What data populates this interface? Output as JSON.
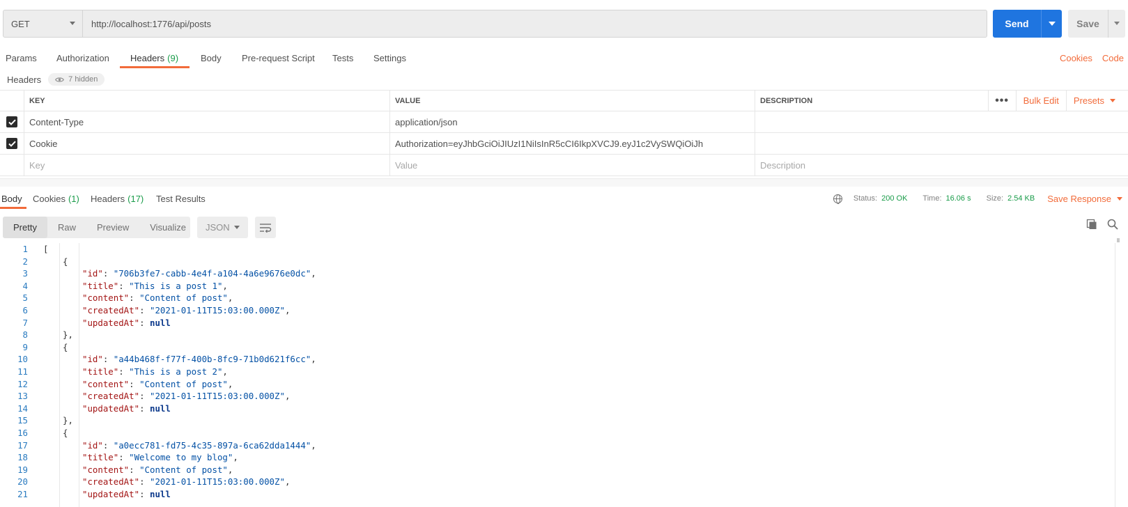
{
  "request": {
    "method": "GET",
    "url": "http://localhost:1776/api/posts",
    "send_label": "Send",
    "save_label": "Save"
  },
  "request_tabs": [
    {
      "label": "Params",
      "count": ""
    },
    {
      "label": "Authorization",
      "count": ""
    },
    {
      "label": "Headers",
      "count": "(9)"
    },
    {
      "label": "Body",
      "count": ""
    },
    {
      "label": "Pre-request Script",
      "count": ""
    },
    {
      "label": "Tests",
      "count": ""
    },
    {
      "label": "Settings",
      "count": ""
    }
  ],
  "active_request_tab": "Headers",
  "right_links": {
    "cookies": "Cookies",
    "code": "Code"
  },
  "headers_section": {
    "label": "Headers",
    "hidden_badge": "7 hidden"
  },
  "headers_table": {
    "columns": {
      "key": "KEY",
      "value": "VALUE",
      "description": "DESCRIPTION"
    },
    "actions": {
      "more": "•••",
      "bulk_edit": "Bulk Edit",
      "presets": "Presets"
    },
    "rows": [
      {
        "checked": true,
        "key": "Content-Type",
        "value": "application/json",
        "description": ""
      },
      {
        "checked": true,
        "key": "Cookie",
        "value": "Authorization=eyJhbGciOiJIUzI1NiIsInR5cCI6IkpXVCJ9.eyJ1c2VySWQiOiJh",
        "description": ""
      }
    ],
    "placeholders": {
      "key": "Key",
      "value": "Value",
      "description": "Description"
    }
  },
  "response_tabs": [
    {
      "label": "Body",
      "count": ""
    },
    {
      "label": "Cookies",
      "count": "(1)"
    },
    {
      "label": "Headers",
      "count": "(17)"
    },
    {
      "label": "Test Results",
      "count": ""
    }
  ],
  "active_response_tab": "Body",
  "response_status": {
    "status_label": "Status:",
    "status_value": "200 OK",
    "time_label": "Time:",
    "time_value": "16.06 s",
    "size_label": "Size:",
    "size_value": "2.54 KB",
    "save_response": "Save Response"
  },
  "view_modes": [
    "Pretty",
    "Raw",
    "Preview",
    "Visualize"
  ],
  "active_view_mode": "Pretty",
  "format": "JSON",
  "colors": {
    "accent": "#f26b3a",
    "send": "#1f75e0",
    "success": "#1a9c4a",
    "json_key": "#a31515",
    "json_string": "#0451a5",
    "json_null": "#0d3a8c",
    "line_number": "#2a7bc0"
  },
  "icons": {
    "eye": "eye-icon",
    "globe": "globe-icon",
    "wrap": "wrap-lines-icon",
    "copy": "copy-icon",
    "search": "search-icon"
  },
  "code_lines": [
    {
      "n": "1",
      "indent": 0,
      "parts": [
        {
          "t": "p",
          "v": "["
        }
      ]
    },
    {
      "n": "2",
      "indent": 1,
      "parts": [
        {
          "t": "p",
          "v": "{"
        }
      ]
    },
    {
      "n": "3",
      "indent": 2,
      "parts": [
        {
          "t": "k",
          "v": "\"id\""
        },
        {
          "t": "p",
          "v": ": "
        },
        {
          "t": "s",
          "v": "\"706b3fe7-cabb-4e4f-a104-4a6e9676e0dc\""
        },
        {
          "t": "p",
          "v": ","
        }
      ]
    },
    {
      "n": "4",
      "indent": 2,
      "parts": [
        {
          "t": "k",
          "v": "\"title\""
        },
        {
          "t": "p",
          "v": ": "
        },
        {
          "t": "s",
          "v": "\"This is a post 1\""
        },
        {
          "t": "p",
          "v": ","
        }
      ]
    },
    {
      "n": "5",
      "indent": 2,
      "parts": [
        {
          "t": "k",
          "v": "\"content\""
        },
        {
          "t": "p",
          "v": ": "
        },
        {
          "t": "s",
          "v": "\"Content of post\""
        },
        {
          "t": "p",
          "v": ","
        }
      ]
    },
    {
      "n": "6",
      "indent": 2,
      "parts": [
        {
          "t": "k",
          "v": "\"createdAt\""
        },
        {
          "t": "p",
          "v": ": "
        },
        {
          "t": "s",
          "v": "\"2021-01-11T15:03:00.000Z\""
        },
        {
          "t": "p",
          "v": ","
        }
      ]
    },
    {
      "n": "7",
      "indent": 2,
      "parts": [
        {
          "t": "k",
          "v": "\"updatedAt\""
        },
        {
          "t": "p",
          "v": ": "
        },
        {
          "t": "n",
          "v": "null"
        }
      ]
    },
    {
      "n": "8",
      "indent": 1,
      "parts": [
        {
          "t": "p",
          "v": "},"
        }
      ]
    },
    {
      "n": "9",
      "indent": 1,
      "parts": [
        {
          "t": "p",
          "v": "{"
        }
      ]
    },
    {
      "n": "10",
      "indent": 2,
      "parts": [
        {
          "t": "k",
          "v": "\"id\""
        },
        {
          "t": "p",
          "v": ": "
        },
        {
          "t": "s",
          "v": "\"a44b468f-f77f-400b-8fc9-71b0d621f6cc\""
        },
        {
          "t": "p",
          "v": ","
        }
      ]
    },
    {
      "n": "11",
      "indent": 2,
      "parts": [
        {
          "t": "k",
          "v": "\"title\""
        },
        {
          "t": "p",
          "v": ": "
        },
        {
          "t": "s",
          "v": "\"This is a post 2\""
        },
        {
          "t": "p",
          "v": ","
        }
      ]
    },
    {
      "n": "12",
      "indent": 2,
      "parts": [
        {
          "t": "k",
          "v": "\"content\""
        },
        {
          "t": "p",
          "v": ": "
        },
        {
          "t": "s",
          "v": "\"Content of post\""
        },
        {
          "t": "p",
          "v": ","
        }
      ]
    },
    {
      "n": "13",
      "indent": 2,
      "parts": [
        {
          "t": "k",
          "v": "\"createdAt\""
        },
        {
          "t": "p",
          "v": ": "
        },
        {
          "t": "s",
          "v": "\"2021-01-11T15:03:00.000Z\""
        },
        {
          "t": "p",
          "v": ","
        }
      ]
    },
    {
      "n": "14",
      "indent": 2,
      "parts": [
        {
          "t": "k",
          "v": "\"updatedAt\""
        },
        {
          "t": "p",
          "v": ": "
        },
        {
          "t": "n",
          "v": "null"
        }
      ]
    },
    {
      "n": "15",
      "indent": 1,
      "parts": [
        {
          "t": "p",
          "v": "},"
        }
      ]
    },
    {
      "n": "16",
      "indent": 1,
      "parts": [
        {
          "t": "p",
          "v": "{"
        }
      ]
    },
    {
      "n": "17",
      "indent": 2,
      "parts": [
        {
          "t": "k",
          "v": "\"id\""
        },
        {
          "t": "p",
          "v": ": "
        },
        {
          "t": "s",
          "v": "\"a0ecc781-fd75-4c35-897a-6ca62dda1444\""
        },
        {
          "t": "p",
          "v": ","
        }
      ]
    },
    {
      "n": "18",
      "indent": 2,
      "parts": [
        {
          "t": "k",
          "v": "\"title\""
        },
        {
          "t": "p",
          "v": ": "
        },
        {
          "t": "s",
          "v": "\"Welcome to my blog\""
        },
        {
          "t": "p",
          "v": ","
        }
      ]
    },
    {
      "n": "19",
      "indent": 2,
      "parts": [
        {
          "t": "k",
          "v": "\"content\""
        },
        {
          "t": "p",
          "v": ": "
        },
        {
          "t": "s",
          "v": "\"Content of post\""
        },
        {
          "t": "p",
          "v": ","
        }
      ]
    },
    {
      "n": "20",
      "indent": 2,
      "parts": [
        {
          "t": "k",
          "v": "\"createdAt\""
        },
        {
          "t": "p",
          "v": ": "
        },
        {
          "t": "s",
          "v": "\"2021-01-11T15:03:00.000Z\""
        },
        {
          "t": "p",
          "v": ","
        }
      ]
    },
    {
      "n": "21",
      "indent": 2,
      "parts": [
        {
          "t": "k",
          "v": "\"updatedAt\""
        },
        {
          "t": "p",
          "v": ": "
        },
        {
          "t": "n",
          "v": "null"
        }
      ]
    }
  ]
}
